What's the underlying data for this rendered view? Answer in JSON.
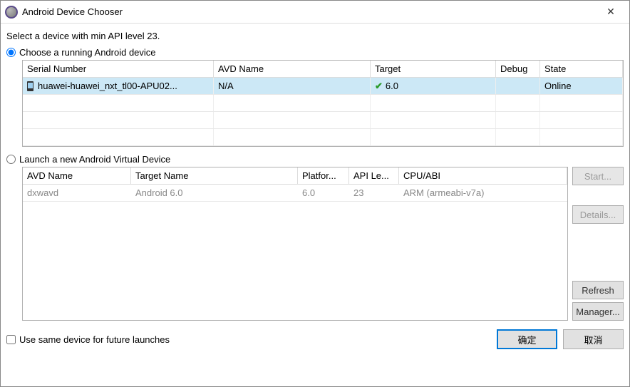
{
  "window": {
    "title": "Android Device Chooser",
    "close_aria": "Close"
  },
  "subtitle": "Select a device with min API level 23.",
  "section_running": {
    "radio_label": "Choose a running Android device",
    "selected": true,
    "columns": {
      "serial": "Serial Number",
      "avd": "AVD Name",
      "target": "Target",
      "debug": "Debug",
      "state": "State"
    },
    "rows": [
      {
        "serial": "huawei-huawei_nxt_tl00-APU02...",
        "avd": "N/A",
        "target": "6.0",
        "target_compatible": true,
        "debug": "",
        "state": "Online",
        "selected": true
      }
    ],
    "empty_rows": 3
  },
  "section_avd": {
    "radio_label": "Launch a new Android Virtual Device",
    "selected": false,
    "columns": {
      "avdname": "AVD Name",
      "targetname": "Target Name",
      "platform": "Platfor...",
      "api": "API Le...",
      "cpu": "CPU/ABI"
    },
    "rows": [
      {
        "avdname": "dxwavd",
        "targetname": "Android 6.0",
        "platform": "6.0",
        "api": "23",
        "cpu": "ARM (armeabi-v7a)"
      }
    ]
  },
  "side_buttons": {
    "start": "Start...",
    "details": "Details...",
    "refresh": "Refresh",
    "manager": "Manager..."
  },
  "footer": {
    "checkbox_label": "Use same device for future launches",
    "ok": "确定",
    "cancel": "取消"
  }
}
